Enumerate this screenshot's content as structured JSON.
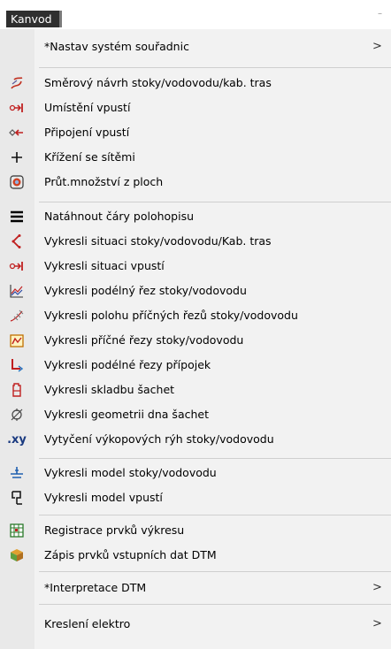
{
  "menubar": {
    "tab_label": "Kanvod",
    "right_mark": "–"
  },
  "menu": {
    "items": [
      {
        "label": "*Nastav systém souřadnic",
        "arrow": ">",
        "icon": ""
      },
      {
        "label": "Směrový návrh stoky/vodovodu/kab. tras",
        "icon": "route-design-icon"
      },
      {
        "label": "Umístění vpustí",
        "icon": "inlet-place-icon"
      },
      {
        "label": "Připojení vpustí",
        "icon": "inlet-connect-icon"
      },
      {
        "label": "Křížení se sítěmi",
        "icon": "crossing-icon"
      },
      {
        "label": "Průt.množství z ploch",
        "icon": "flow-area-icon"
      },
      {
        "label": "Natáhnout čáry polohopisu",
        "icon": "lines-icon"
      },
      {
        "label": "Vykresli situaci stoky/vodovodu/Kab. tras",
        "icon": "situation-icon"
      },
      {
        "label": "Vykresli situaci vpustí",
        "icon": "inlet-situation-icon"
      },
      {
        "label": "Vykresli podélný řez stoky/vodovodu",
        "icon": "longitudinal-profile-icon"
      },
      {
        "label": "Vykresli polohu příčných řezů stoky/vodovodu",
        "icon": "cross-position-icon"
      },
      {
        "label": "Vykresli příčné řezy stoky/vodovodu",
        "icon": "cross-section-icon"
      },
      {
        "label": "Vykresli podélné řezy přípojek",
        "icon": "connection-profile-icon"
      },
      {
        "label": "Vykresli skladbu šachet",
        "icon": "manhole-composition-icon"
      },
      {
        "label": "Vykresli geometrii dna šachet",
        "icon": "manhole-bottom-icon"
      },
      {
        "label": "Vytyčení výkopových rýh stoky/vodovodu",
        "icon": "xy-icon",
        "icon_text": ".xy"
      },
      {
        "label": "Vykresli model stoky/vodovodu",
        "icon": "sewer-model-icon"
      },
      {
        "label": "Vykresli model vpustí",
        "icon": "inlet-model-icon"
      },
      {
        "label": "Registrace prvků výkresu",
        "icon": "registration-icon"
      },
      {
        "label": "Zápis prvků vstupních dat DTM",
        "icon": "dtm-write-icon"
      },
      {
        "label": "*Interpretace DTM",
        "arrow": ">",
        "icon": ""
      },
      {
        "label": "Kreslení elektro",
        "arrow": ">",
        "icon": ""
      }
    ]
  }
}
